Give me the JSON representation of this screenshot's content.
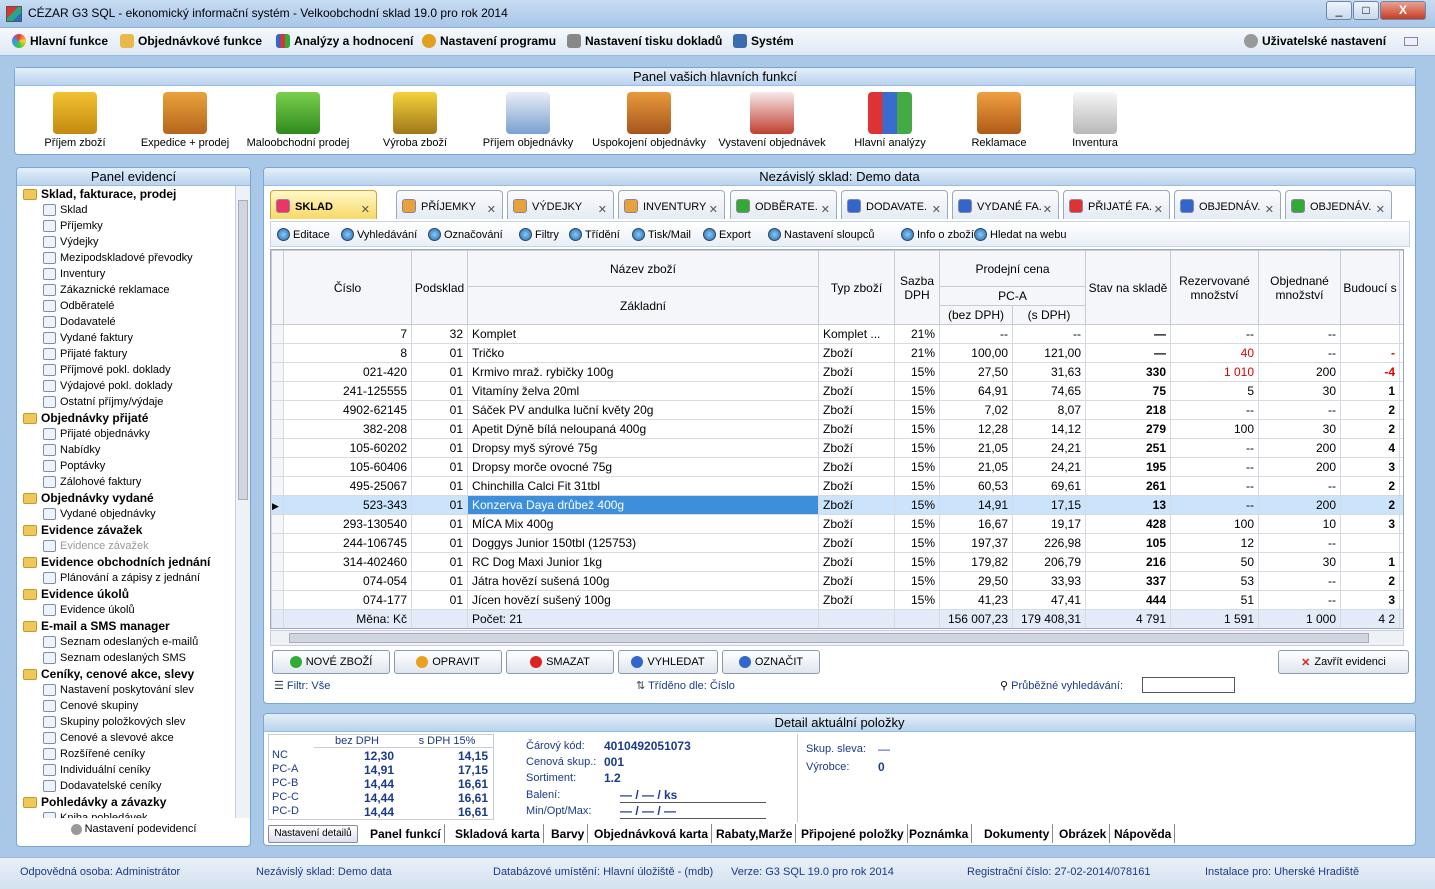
{
  "window": {
    "title": "CÉZAR G3 SQL - ekonomický informační systém - Velkoobchodní sklad 19.0 pro rok 2014",
    "min": "_",
    "max": "□",
    "close": "X"
  },
  "menu": {
    "items": [
      "Hlavní funkce",
      "Objednávkové funkce",
      "Analýzy a hodnocení",
      "Nastavení programu",
      "Nastavení tisku dokladů",
      "Systém"
    ],
    "user_settings": "Uživatelské nastavení"
  },
  "func_panel": {
    "title": "Panel vašich hlavních funkcí",
    "items": [
      "Příjem zboží",
      "Expedice + prodej",
      "Maloobchodní prodej",
      "Výroba zboží",
      "Příjem objednávky",
      "Uspokojení objednávky",
      "Vystavení objednávek",
      "Hlavní analýzy",
      "Reklamace",
      "Inventura"
    ]
  },
  "evid_panel": {
    "title": "Panel evidencí",
    "footer": "Nastavení podevidencí",
    "tree": [
      {
        "t": "Sklad, fakturace, prodej",
        "g": true
      },
      {
        "t": "Sklad"
      },
      {
        "t": "Příjemky"
      },
      {
        "t": "Výdejky"
      },
      {
        "t": "Mezipodskladové převodky"
      },
      {
        "t": "Inventury"
      },
      {
        "t": "Zákaznické reklamace"
      },
      {
        "t": "Odběratelé"
      },
      {
        "t": "Dodavatelé"
      },
      {
        "t": "Vydané faktury"
      },
      {
        "t": "Přijaté faktury"
      },
      {
        "t": "Příjmové pokl. doklady"
      },
      {
        "t": "Výdajové pokl. doklady"
      },
      {
        "t": "Ostatní příjmy/výdaje"
      },
      {
        "t": "Objednávky přijaté",
        "g": true
      },
      {
        "t": "Přijaté objednávky"
      },
      {
        "t": "Nabídky"
      },
      {
        "t": "Poptávky"
      },
      {
        "t": "Zálohové faktury"
      },
      {
        "t": "Objednávky vydané",
        "g": true
      },
      {
        "t": "Vydané objednávky"
      },
      {
        "t": "Evidence závažek",
        "g": true
      },
      {
        "t": "Evidence závažek",
        "dis": true
      },
      {
        "t": "Evidence obchodních jednání",
        "g": true
      },
      {
        "t": "Plánování a zápisy z jednání"
      },
      {
        "t": "Evidence úkolů",
        "g": true
      },
      {
        "t": "Evidence úkolů"
      },
      {
        "t": "E-mail a SMS manager",
        "g": true
      },
      {
        "t": "Seznam odeslaných e-mailů"
      },
      {
        "t": "Seznam odeslaných SMS"
      },
      {
        "t": "Ceníky, cenové akce, slevy",
        "g": true
      },
      {
        "t": "Nastavení poskytování slev"
      },
      {
        "t": "Cenové skupiny"
      },
      {
        "t": "Skupiny položkových slev"
      },
      {
        "t": "Cenové a slevové akce"
      },
      {
        "t": "Rozšířené ceníky"
      },
      {
        "t": "Individuální ceníky"
      },
      {
        "t": "Dodavatelské ceníky"
      },
      {
        "t": "Pohledávky a závazky",
        "g": true
      },
      {
        "t": "Kniha pohledávek"
      }
    ]
  },
  "main": {
    "title": "Nezávislý sklad: Demo data",
    "tabs": [
      "SKLAD",
      "PŘÍJEMKY",
      "VÝDEJKY",
      "INVENTURY",
      "ODBĚRATE.",
      "DODAVATE.",
      "VYDANÉ FA.",
      "PŘIJATÉ FA.",
      "OBJEDNÁV.",
      "OBJEDNÁV."
    ],
    "toolbar": [
      "Editace",
      "Vyhledávání",
      "Označování",
      "Filtry",
      "Třídění",
      "Tisk/Mail",
      "Export",
      "Nastavení sloupců",
      "Info o zboží",
      "Hledat na webu"
    ],
    "headers": {
      "cislo": "Číslo",
      "podsklad": "Podsklad",
      "nazev": "Název zboží",
      "zakladni": "Základní",
      "typ": "Typ zboží",
      "dph": "Sazba DPH",
      "prodejni": "Prodejní cena",
      "pca": "PC-A",
      "bez": "(bez DPH)",
      "s": "(s DPH)",
      "stav": "Stav na skladě",
      "rez": "Rezervované množství",
      "obj": "Objednané množství",
      "bud": "Budoucí s"
    },
    "rows": [
      [
        "7",
        "32",
        "Komplet",
        "Komplet ...",
        "21%",
        "--",
        "--",
        "—",
        "--",
        "--",
        ""
      ],
      [
        "8",
        "01",
        "Tričko",
        "Zboží",
        "21%",
        "100,00",
        "121,00",
        "—",
        "40",
        "--",
        "-"
      ],
      [
        "021-420",
        "01",
        "Krmivo mraž. rybičky 100g",
        "Zboží",
        "15%",
        "27,50",
        "31,63",
        "330",
        "1 010",
        "200",
        "-4"
      ],
      [
        "241-125555",
        "01",
        "Vitamíny želva 20ml",
        "Zboží",
        "15%",
        "64,91",
        "74,65",
        "75",
        "5",
        "30",
        "1"
      ],
      [
        "4902-62145",
        "01",
        "Sáček PV andulka luční květy 20g",
        "Zboží",
        "15%",
        "7,02",
        "8,07",
        "218",
        "--",
        "--",
        "2"
      ],
      [
        "382-208",
        "01",
        "Apetit Dýně bílá neloupaná 400g",
        "Zboží",
        "15%",
        "12,28",
        "14,12",
        "279",
        "100",
        "30",
        "2"
      ],
      [
        "105-60202",
        "01",
        "Dropsy myš sýrové 75g",
        "Zboží",
        "15%",
        "21,05",
        "24,21",
        "251",
        "--",
        "200",
        "4"
      ],
      [
        "105-60406",
        "01",
        "Dropsy morče ovocné 75g",
        "Zboží",
        "15%",
        "21,05",
        "24,21",
        "195",
        "--",
        "200",
        "3"
      ],
      [
        "495-25067",
        "01",
        "Chinchilla Calci Fit 31tbl",
        "Zboží",
        "15%",
        "60,53",
        "69,61",
        "261",
        "--",
        "--",
        "2"
      ],
      [
        "523-343",
        "01",
        "Konzerva Daya drůbež 400g",
        "Zboží",
        "15%",
        "14,91",
        "17,15",
        "13",
        "--",
        "200",
        "2"
      ],
      [
        "293-130540",
        "01",
        "MÍCA Mix 400g",
        "Zboží",
        "15%",
        "16,67",
        "19,17",
        "428",
        "100",
        "10",
        "3"
      ],
      [
        "244-106745",
        "01",
        "Doggys Junior 150tbl (125753)",
        "Zboží",
        "15%",
        "197,37",
        "226,98",
        "105",
        "12",
        "--",
        ""
      ],
      [
        "314-402460",
        "01",
        "RC Dog Maxi Junior 1kg",
        "Zboží",
        "15%",
        "179,82",
        "206,79",
        "216",
        "50",
        "30",
        "1"
      ],
      [
        "074-054",
        "01",
        "Játra hovězí sušená 100g",
        "Zboží",
        "15%",
        "29,50",
        "33,93",
        "337",
        "53",
        "--",
        "2"
      ],
      [
        "074-177",
        "01",
        "Jícen hovězí sušený 100g",
        "Zboží",
        "15%",
        "41,23",
        "47,41",
        "444",
        "51",
        "--",
        "3"
      ]
    ],
    "footer": [
      "Měna: Kč",
      "Počet: 21",
      "156 007,23",
      "179 408,31",
      "4 791",
      "1 591",
      "1 000",
      "4 2"
    ],
    "actions": [
      "NOVÉ ZBOŽÍ",
      "OPRAVIT",
      "SMAZAT",
      "VYHLEDAT",
      "OZNAČIT",
      "Zavřít evidenci"
    ],
    "filter_label": "Filtr:",
    "filter_value": "Vše",
    "sort_label": "Tříděno dle:",
    "sort_value": "Číslo",
    "search_label": "Průběžné vyhledávání:"
  },
  "detail": {
    "title": "Detail aktuální položky",
    "col_bez": "bez DPH",
    "col_s": "s DPH 15%",
    "prices": [
      [
        "NC",
        "12,30",
        "14,15"
      ],
      [
        "PC-A",
        "14,91",
        "17,15"
      ],
      [
        "PC-B",
        "14,44",
        "16,61"
      ],
      [
        "PC-C",
        "14,44",
        "16,61"
      ],
      [
        "PC-D",
        "14,44",
        "16,61"
      ]
    ],
    "barcode_l": "Čárový kód:",
    "barcode": "4010492051073",
    "censkup_l": "Cenová skup.:",
    "censkup": "001",
    "sortiment_l": "Sortiment:",
    "sortiment": "1.2",
    "baleni_l": "Balení:",
    "baleni": "—   /   —   /   ks",
    "minmax_l": "Min/Opt/Max:",
    "minmax": "—   /   —   /   —",
    "skup_l": "Skup. sleva:",
    "skup": "—",
    "vyrobce_l": "Výrobce:",
    "vyrobce": "0",
    "settings_btn": "Nastavení detailů",
    "tabs": [
      "Panel funkcí",
      "Skladová karta",
      "Barvy",
      "Objednávková karta",
      "Rabaty,Marže",
      "Připojené položky",
      "Poznámka",
      "Dokumenty",
      "Obrázek",
      "Nápověda"
    ]
  },
  "status": {
    "odp_l": "Odpovědná osoba:",
    "odp": "Administrátor",
    "sklad_l": "Nezávislý sklad:",
    "sklad": "Demo data",
    "db_l": "Databázové umístění:",
    "db": "Hlavní úložiště - (mdb)",
    "ver_l": "Verze:",
    "ver": "G3 SQL 19.0 pro rok 2014",
    "reg_l": "Registrační číslo:",
    "reg": "27-02-2014/078161",
    "inst_l": "Instalace pro:",
    "inst": "Uherské Hradiště"
  }
}
